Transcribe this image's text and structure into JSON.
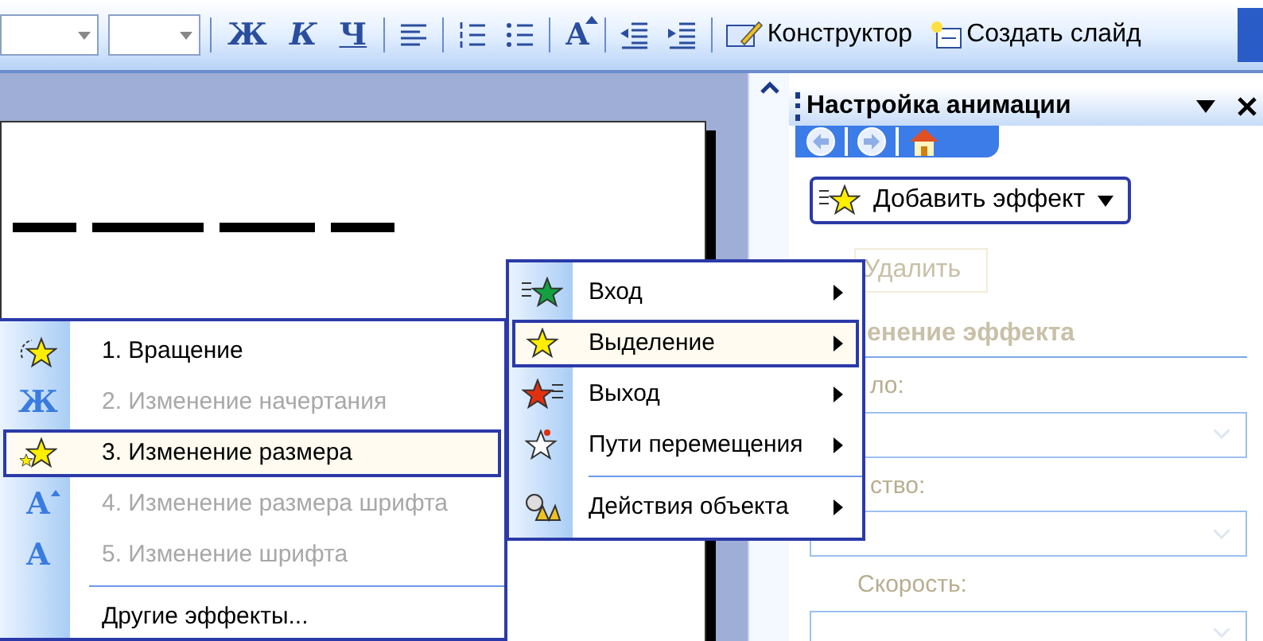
{
  "toolbar": {
    "items": [
      {
        "kind": "combo"
      },
      {
        "kind": "combo"
      },
      {
        "kind": "sep"
      },
      {
        "kind": "glyph",
        "label": "Ж"
      },
      {
        "kind": "glyph",
        "label": "К"
      },
      {
        "kind": "glyph",
        "label": "Ч"
      },
      {
        "kind": "sep"
      },
      {
        "kind": "icon"
      },
      {
        "kind": "sep"
      },
      {
        "kind": "icon"
      },
      {
        "kind": "icon"
      },
      {
        "kind": "sep"
      },
      {
        "kind": "glyph",
        "label": "A"
      },
      {
        "kind": "sep"
      },
      {
        "kind": "icon"
      },
      {
        "kind": "icon"
      },
      {
        "kind": "sep"
      },
      {
        "kind": "labeled",
        "label": "Конструктор"
      },
      {
        "kind": "labeled",
        "label": "Создать слайд"
      }
    ]
  },
  "task_pane": {
    "title": "Настройка анимации",
    "add_effect_button": "Добавить эффект",
    "remove_button": {
      "label": "Удалить",
      "disabled": true
    },
    "section_heading": "енение эффекта",
    "fields": [
      {
        "label": "ло:"
      },
      {
        "label": "ство:"
      },
      {
        "label": "Скорость:"
      }
    ]
  },
  "effect_menu": {
    "items": [
      {
        "kind": "item",
        "label": "Вход",
        "selected": false
      },
      {
        "kind": "item",
        "label": "Выделение",
        "selected": true
      },
      {
        "kind": "item",
        "label": "Выход",
        "selected": false
      },
      {
        "kind": "item",
        "label": "Пути перемещения",
        "selected": false
      },
      {
        "kind": "sep"
      },
      {
        "kind": "item",
        "label": "Действия объекта",
        "selected": false
      }
    ]
  },
  "emphasis_menu": {
    "items": [
      {
        "kind": "item",
        "label": "1. Вращение",
        "selected": false,
        "disabled": false
      },
      {
        "kind": "item",
        "glyph": "Ж",
        "label": "2. Изменение начертания",
        "selected": false,
        "disabled": true
      },
      {
        "kind": "item",
        "label": "3. Изменение размера",
        "selected": true,
        "disabled": false
      },
      {
        "kind": "item",
        "glyph": "A",
        "label": "4. Изменение размера шрифта",
        "selected": false,
        "disabled": true
      },
      {
        "kind": "item",
        "glyph": "A",
        "label": "5. Изменение шрифта",
        "selected": false,
        "disabled": true
      },
      {
        "kind": "sep"
      },
      {
        "kind": "item",
        "label": "Другие эффекты...",
        "selected": false,
        "disabled": false
      }
    ]
  }
}
